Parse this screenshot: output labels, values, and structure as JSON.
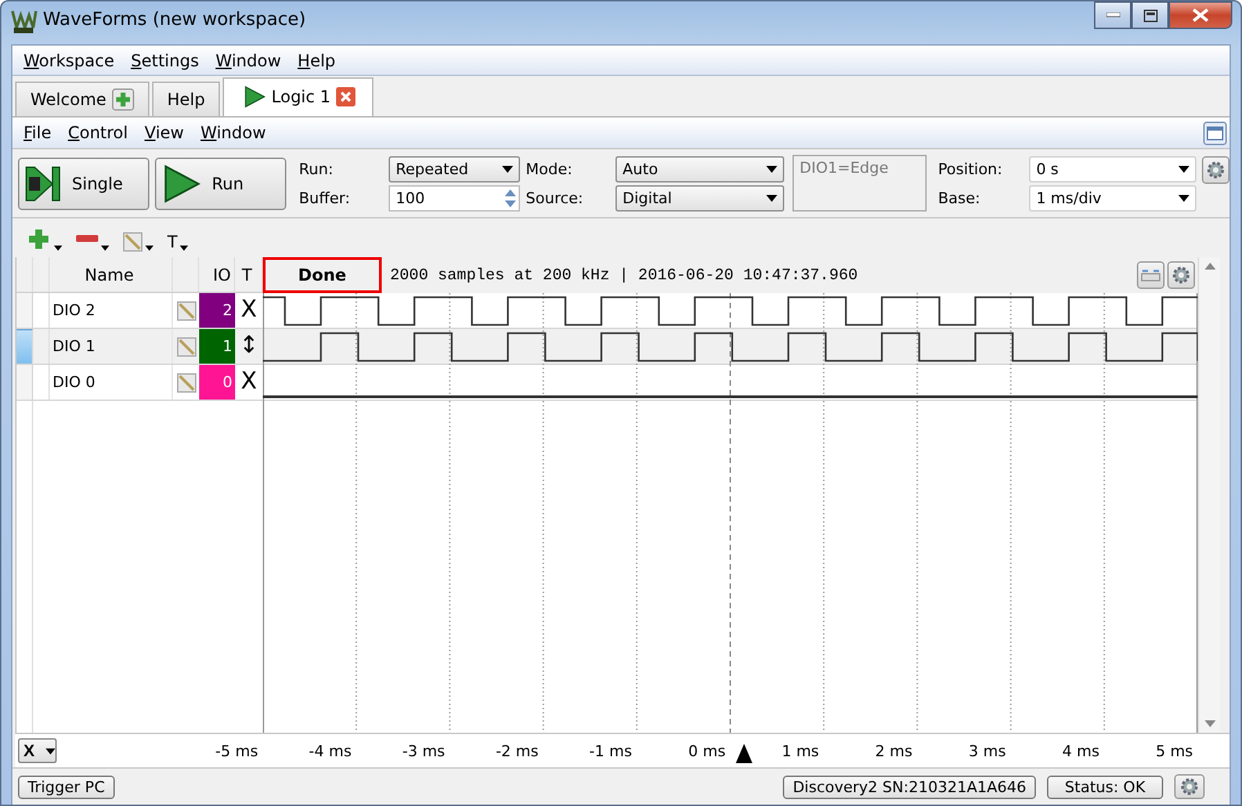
{
  "window": {
    "title": "WaveForms  (new workspace)"
  },
  "main_menu": [
    "Workspace",
    "Settings",
    "Window",
    "Help"
  ],
  "tabs": [
    {
      "label": "Welcome",
      "kind": "add",
      "selected": false
    },
    {
      "label": "Help",
      "kind": "plain",
      "selected": false
    },
    {
      "label": "Logic 1",
      "kind": "instrument",
      "selected": true
    }
  ],
  "instrument_menu": [
    "File",
    "Control",
    "View",
    "Window"
  ],
  "run_buttons": [
    {
      "label": "Single",
      "kind": "single"
    },
    {
      "label": "Run",
      "kind": "run"
    }
  ],
  "acquisition": [
    {
      "label": "Run:",
      "value": "Repeated",
      "kind": "dropdown"
    },
    {
      "label": "Buffer:",
      "value": "100",
      "kind": "spinbox"
    }
  ],
  "trigger": [
    {
      "label": "Mode:",
      "value": "Auto",
      "kind": "dropdown"
    },
    {
      "label": "Source:",
      "value": "Digital",
      "kind": "dropdown"
    }
  ],
  "trigger_summary": "DIO1=Edge",
  "time": [
    {
      "label": "Position:",
      "value": "0 s",
      "kind": "dropdown"
    },
    {
      "label": "Base:",
      "value": "1 ms/div",
      "kind": "dropdown"
    }
  ],
  "channel_tools": [
    {
      "kind": "add"
    },
    {
      "kind": "remove"
    },
    {
      "kind": "edit"
    },
    {
      "kind": "text",
      "label": "T"
    }
  ],
  "columns": [
    "Name",
    "IO",
    "T"
  ],
  "acquisition_status": "Done",
  "acquisition_info": "2000 samples at 200 kHz | 2016-06-20 10:47:37.960",
  "channels": [
    {
      "name": "DIO 2",
      "io": "2",
      "color": "#800080",
      "trigger": "X",
      "selected": false
    },
    {
      "name": "DIO 1",
      "io": "1",
      "color": "#006400",
      "trigger": "↕",
      "selected": true
    },
    {
      "name": "DIO 0",
      "io": "0",
      "color": "#ff1493",
      "trigger": "X",
      "selected": false
    }
  ],
  "axis": {
    "select": "X",
    "ticks": [
      "-5 ms",
      "-4 ms",
      "-3 ms",
      "-2 ms",
      "-1 ms",
      "0 ms",
      "1 ms",
      "2 ms",
      "3 ms",
      "4 ms",
      "5 ms"
    ]
  },
  "status_bar": {
    "trigger_button": "Trigger PC",
    "device": "Discovery2 SN:210321A1A646",
    "status": "Status: OK"
  }
}
